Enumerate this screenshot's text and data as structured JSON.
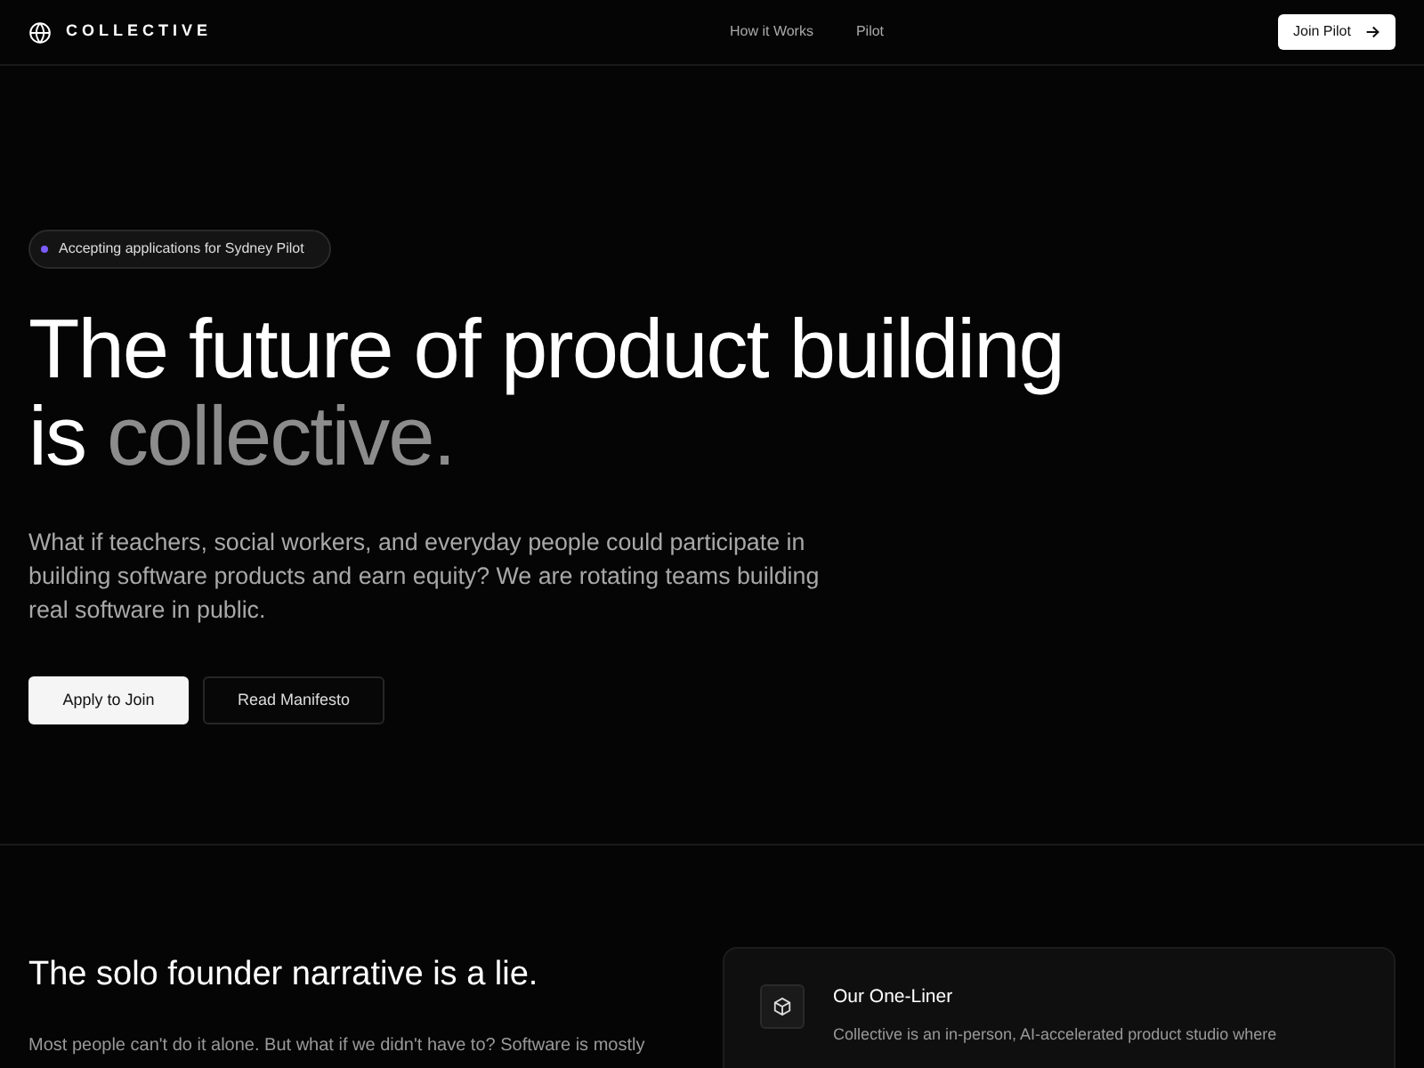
{
  "navbar": {
    "brand": "COLLECTIVE",
    "links": [
      {
        "label": "How it Works"
      },
      {
        "label": "Pilot"
      }
    ],
    "cta": "Join Pilot"
  },
  "hero": {
    "badge": {
      "text": "Accepting applications for Sydney Pilot",
      "color": "#7c5cff"
    },
    "headline": "The future of product building",
    "headline_line2_prefix": "is",
    "headline_highlight": "collective.",
    "lead": "What if teachers, social workers, and everyday people could participate in building software products and earn equity? We are rotating teams building real software in public.",
    "buttons": [
      {
        "label": "Apply to Join",
        "kind": "primary"
      },
      {
        "label": "Read Manifesto",
        "kind": "outline"
      }
    ]
  },
  "section": {
    "heading": "The solo founder narrative is a lie.",
    "text": "Most people can't do it alone. But what if we didn't have to? Software is mostly",
    "card": {
      "title": "Our One-Liner",
      "text": "Collective is an in-person, AI-accelerated product studio where"
    }
  }
}
